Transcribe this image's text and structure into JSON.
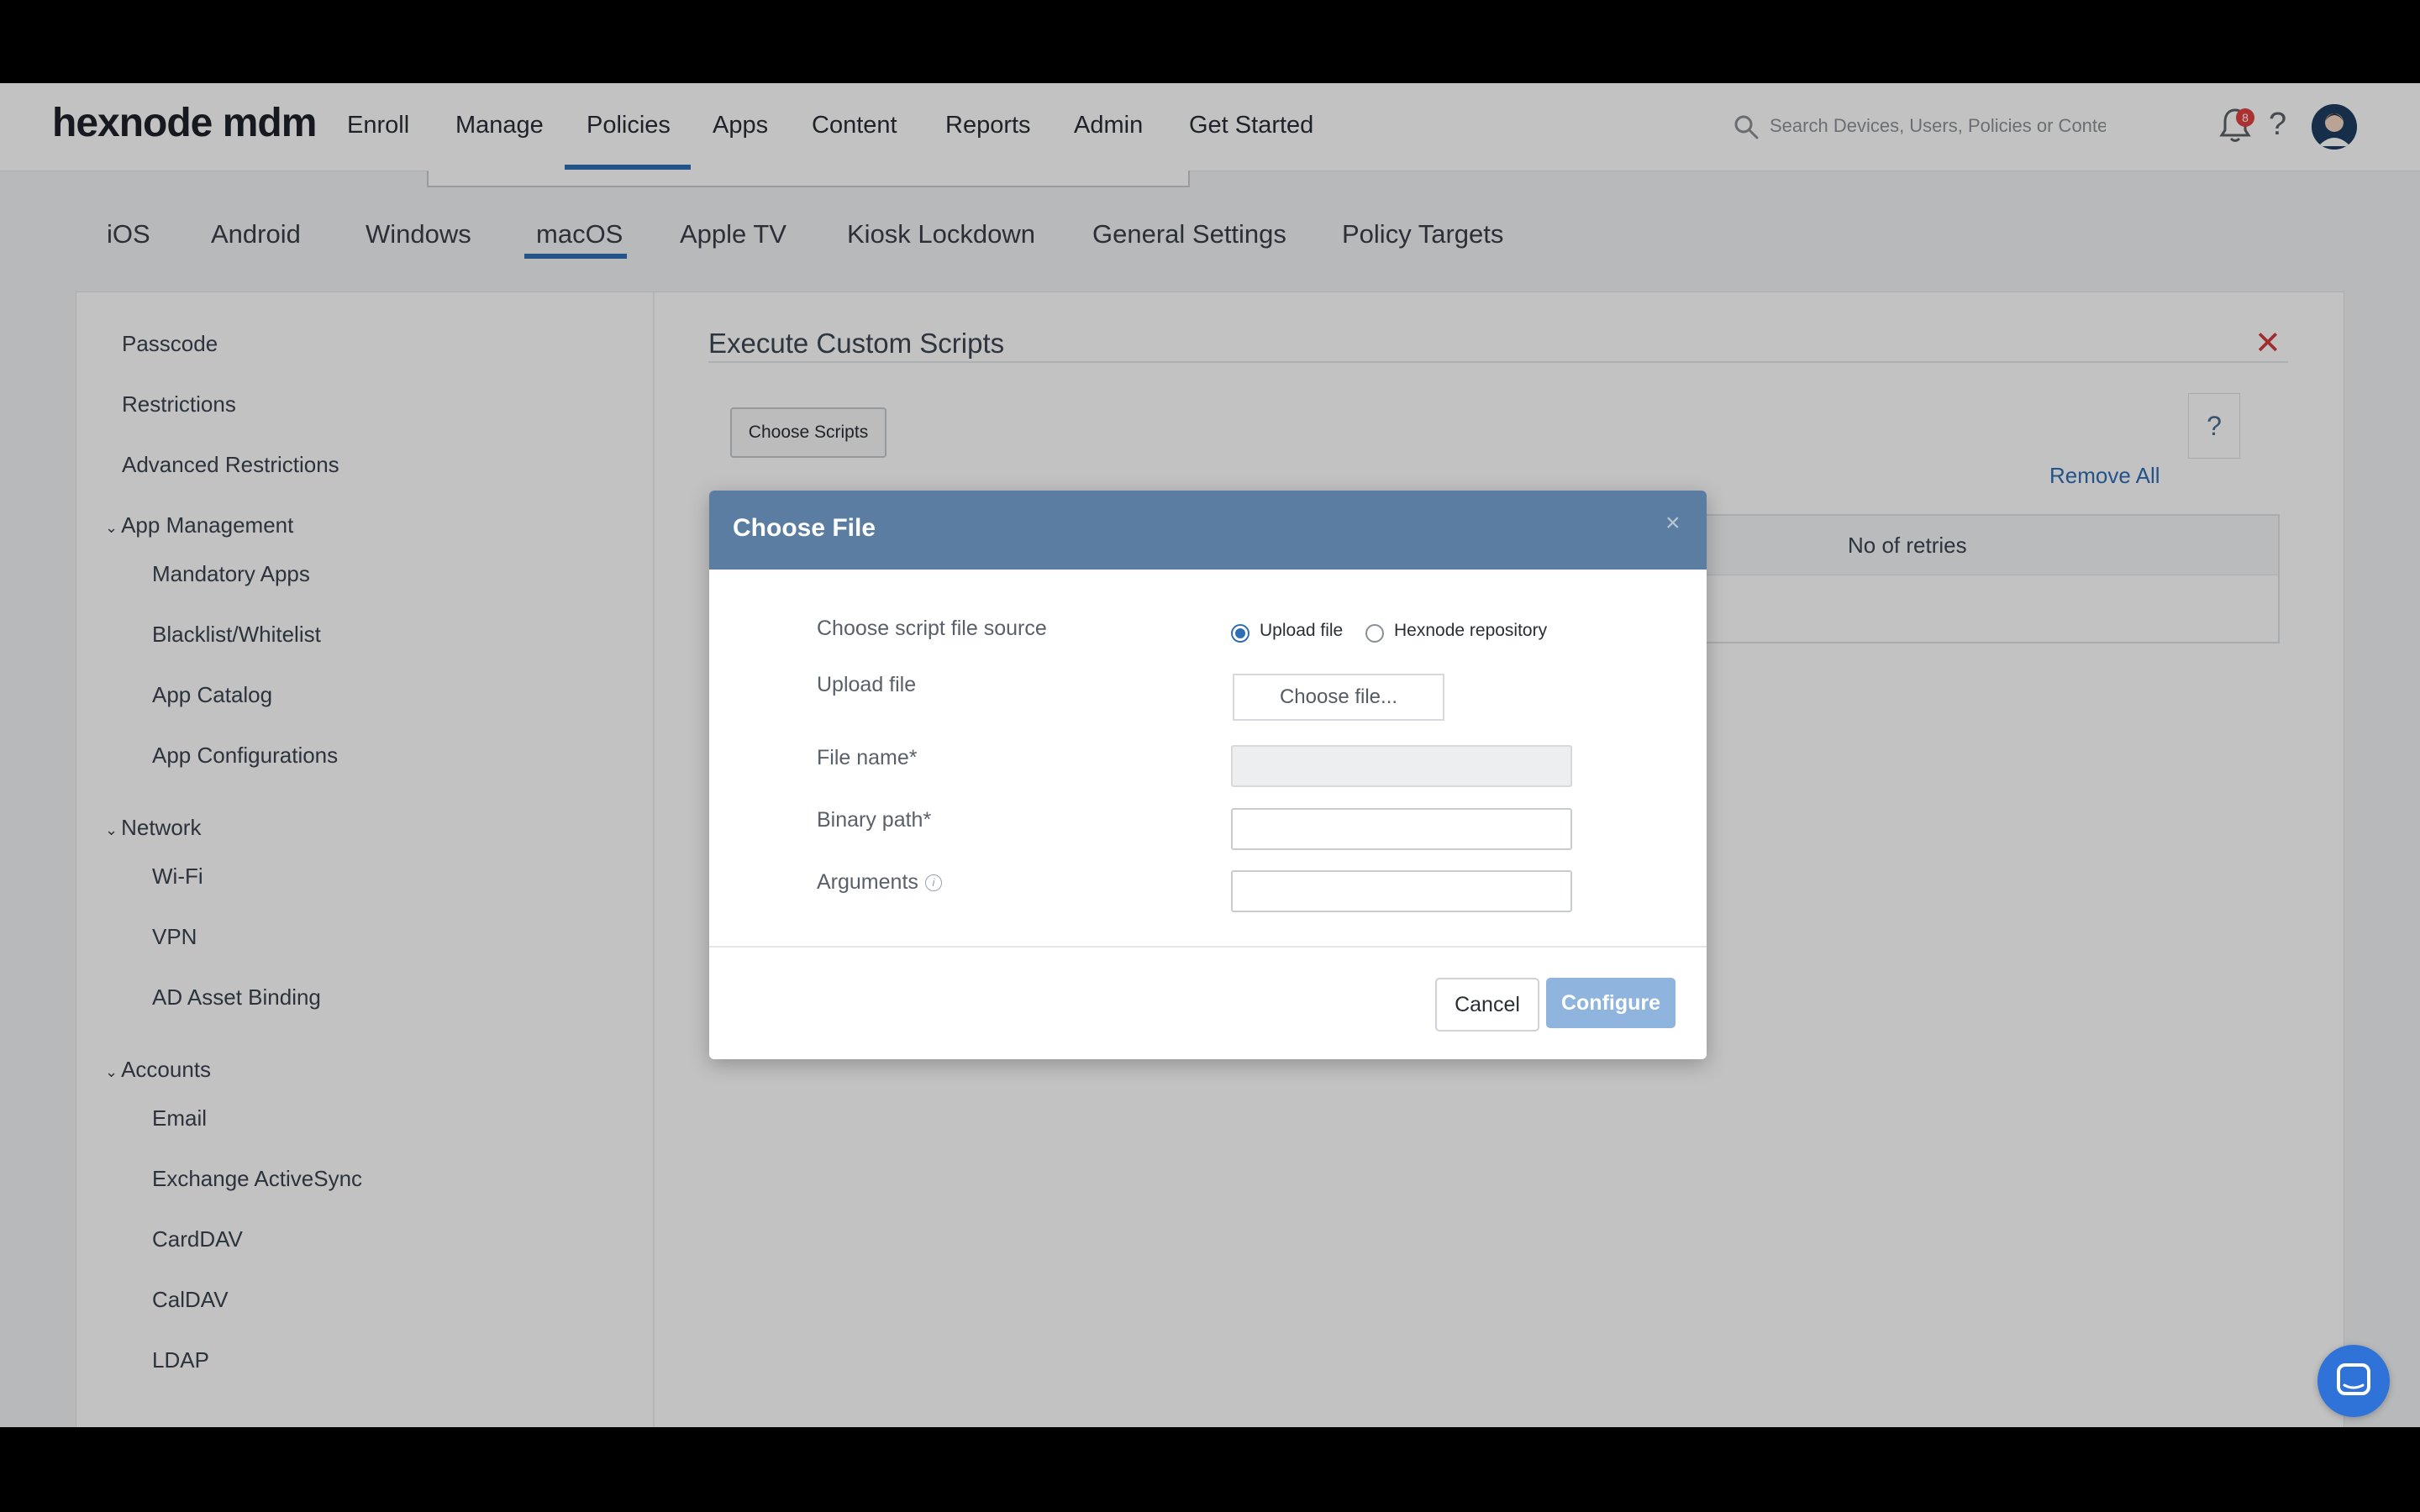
{
  "logo": "hexnode mdm",
  "nav": {
    "items": [
      "Enroll",
      "Manage",
      "Policies",
      "Apps",
      "Content",
      "Reports",
      "Admin",
      "Get Started"
    ],
    "active": "Policies"
  },
  "search": {
    "placeholder": "Search Devices, Users, Policies or Content"
  },
  "notifications": {
    "count": "8"
  },
  "help_label": "?",
  "platform_tabs": {
    "items": [
      "iOS",
      "Android",
      "Windows",
      "macOS",
      "Apple TV",
      "Kiosk Lockdown",
      "General Settings",
      "Policy Targets"
    ],
    "active": "macOS"
  },
  "sidebar": {
    "top_items": [
      "Passcode",
      "Restrictions",
      "Advanced Restrictions"
    ],
    "groups": [
      {
        "label": "App Management",
        "items": [
          "Mandatory Apps",
          "Blacklist/Whitelist",
          "App Catalog",
          "App Configurations"
        ]
      },
      {
        "label": "Network",
        "items": [
          "Wi-Fi",
          "VPN",
          "AD Asset Binding"
        ]
      },
      {
        "label": "Accounts",
        "items": [
          "Email",
          "Exchange ActiveSync",
          "CardDAV",
          "CalDAV",
          "LDAP"
        ]
      }
    ]
  },
  "section": {
    "title": "Execute Custom Scripts",
    "choose_scripts_label": "Choose Scripts",
    "remove_all_label": "Remove All",
    "help_label": "?",
    "table_headers": [
      "No of retries"
    ]
  },
  "modal": {
    "title": "Choose File",
    "source_label": "Choose script file source",
    "source_options": [
      "Upload file",
      "Hexnode repository"
    ],
    "source_selected": "Upload file",
    "upload_label": "Upload file",
    "choose_file_label": "Choose file...",
    "file_name_label": "File name*",
    "file_name_value": "",
    "binary_path_label": "Binary path*",
    "binary_path_value": "",
    "arguments_label": "Arguments",
    "arguments_value": "",
    "cancel_label": "Cancel",
    "configure_label": "Configure"
  },
  "colors": {
    "accent": "#2f6eb5",
    "modal_header": "#5b7da1",
    "close_red": "#d23c3c",
    "configure_button": "#8fb4de"
  },
  "icons": [
    "search-icon",
    "bell-icon",
    "help-icon",
    "avatar-icon",
    "close-icon",
    "cursor-icon",
    "info-icon",
    "chat-icon"
  ]
}
